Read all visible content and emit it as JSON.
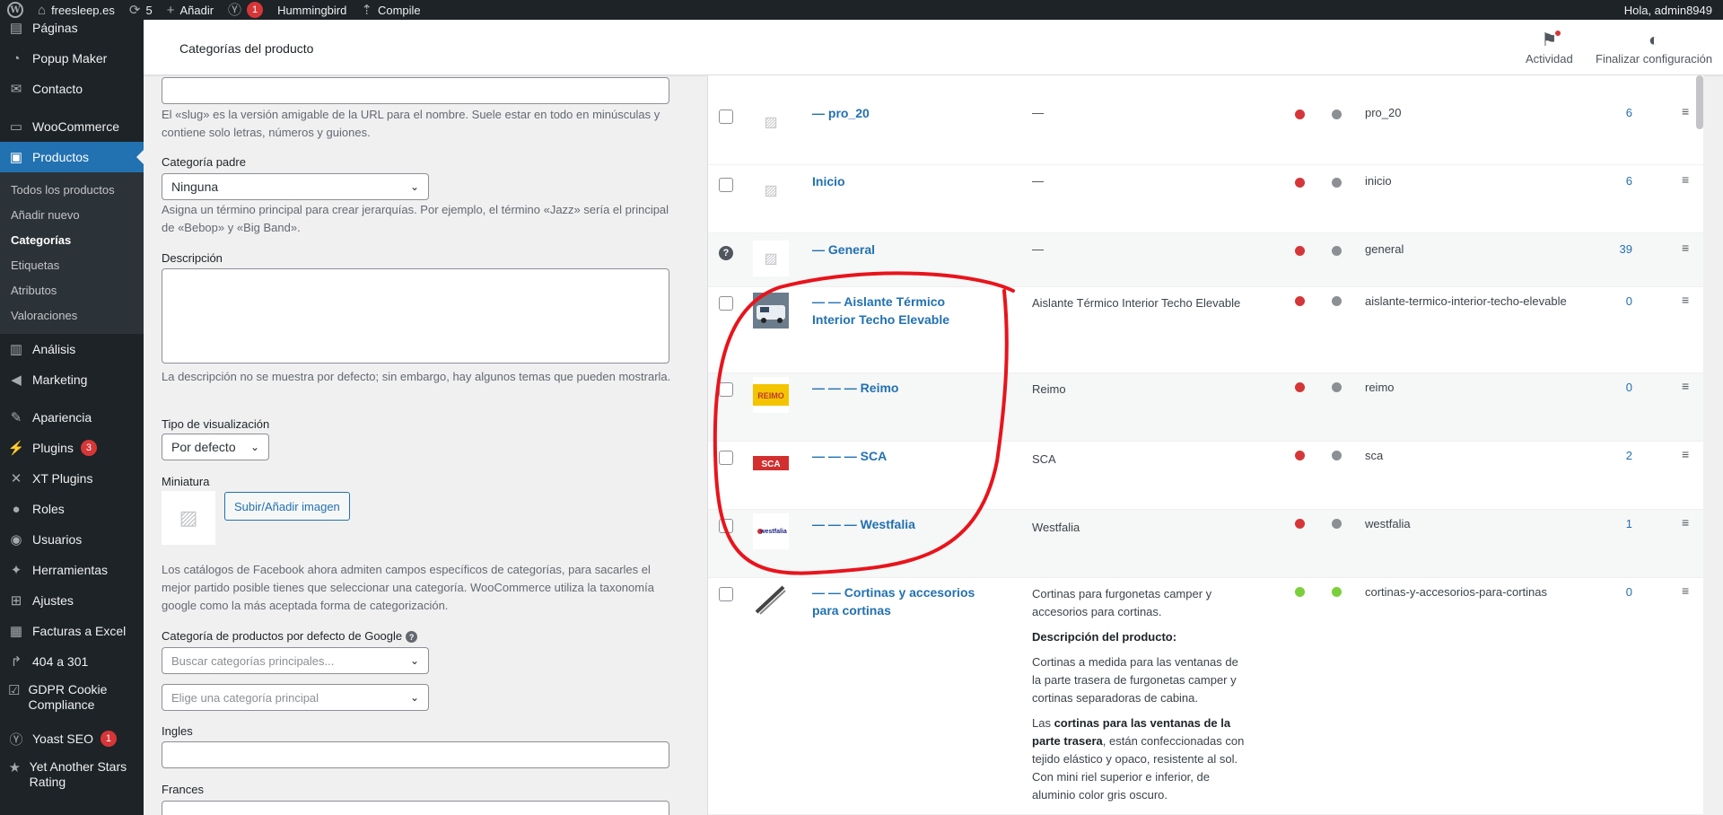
{
  "adminbar": {
    "site": "freesleep.es",
    "updates": "5",
    "add": "Añadir",
    "yoast_count": "1",
    "hummingbird": "Hummingbird",
    "compile": "Compile",
    "greeting": "Hola, admin8949"
  },
  "sidebar": {
    "items": [
      {
        "label": "Páginas",
        "icon": "page-icon"
      },
      {
        "label": "Popup Maker",
        "icon": "popup-icon"
      },
      {
        "label": "Contacto",
        "icon": "mail-icon"
      },
      {
        "label": "WooCommerce",
        "icon": "woo-icon"
      },
      {
        "label": "Productos",
        "icon": "archive-icon"
      }
    ],
    "submenu": [
      "Todos los productos",
      "Añadir nuevo",
      "Categorías",
      "Etiquetas",
      "Atributos",
      "Valoraciones"
    ],
    "items2": [
      {
        "label": "Análisis",
        "icon": "chart-icon"
      },
      {
        "label": "Marketing",
        "icon": "megaphone-icon"
      },
      {
        "label": "Apariencia",
        "icon": "brush-icon"
      },
      {
        "label": "Plugins",
        "icon": "plugin-icon",
        "badge": "3"
      },
      {
        "label": "XT Plugins",
        "icon": "xt-icon"
      },
      {
        "label": "Roles",
        "icon": "roles-icon"
      },
      {
        "label": "Usuarios",
        "icon": "user-icon"
      },
      {
        "label": "Herramientas",
        "icon": "wrench-icon"
      },
      {
        "label": "Ajustes",
        "icon": "settings-icon"
      },
      {
        "label": "Facturas a Excel",
        "icon": "spreadsheet-icon"
      },
      {
        "label": "404 a 301",
        "icon": "redirect-icon"
      },
      {
        "label": "GDPR Cookie Compliance",
        "icon": "shield-icon"
      },
      {
        "label": "Yoast SEO",
        "icon": "yoast-icon",
        "badge": "1"
      },
      {
        "label": "Yet Another Stars Rating",
        "icon": "star-icon"
      }
    ]
  },
  "header": {
    "title": "Categorías del producto",
    "activity": "Actividad",
    "finish": "Finalizar configuración"
  },
  "form": {
    "slug_hint": "El «slug» es la versión amigable de la URL para el nombre. Suele estar en todo en minúsculas y contiene solo letras, números y guiones.",
    "parent_label": "Categoría padre",
    "parent_value": "Ninguna",
    "parent_hint": "Asigna un término principal para crear jerarquías. Por ejemplo, el término «Jazz» sería el principal de «Bebop» y «Big Band».",
    "desc_label": "Descripción",
    "desc_hint": "La descripción no se muestra por defecto; sin embargo, hay algunos temas que pueden mostrarla.",
    "display_label": "Tipo de visualización",
    "display_value": "Por defecto",
    "thumb_label": "Miniatura",
    "upload_btn": "Subir/Añadir imagen",
    "fb_hint": "Los catálogos de Facebook ahora admiten campos específicos de categorías, para sacarles el mejor partido posible tienes que seleccionar una categoría. WooCommerce utiliza la taxonomía google como la más aceptada forma de categorización.",
    "google_label": "Categoría de productos por defecto de Google",
    "google_search_ph": "Buscar categorías principales...",
    "google_choose_ph": "Elige una categoría principal",
    "ingles_label": "Ingles",
    "frances_label": "Frances"
  },
  "table": {
    "rows": [
      {
        "name": "— pro_20",
        "desc": "—",
        "slug": "pro_20",
        "count": "6",
        "status1": "red",
        "status2": "gray"
      },
      {
        "name": "Inicio",
        "desc": "—",
        "slug": "inicio",
        "count": "6",
        "status1": "red",
        "status2": "gray"
      },
      {
        "name": "— General",
        "desc": "—",
        "slug": "general",
        "count": "39",
        "status1": "red",
        "status2": "gray"
      },
      {
        "name": "— — Aislante Térmico Interior Techo Elevable",
        "desc": "Aislante Térmico Interior Techo Elevable",
        "slug": "aislante-termico-interior-techo-elevable",
        "count": "0",
        "status1": "red",
        "status2": "gray"
      },
      {
        "name": "— — — Reimo",
        "desc": "Reimo",
        "slug": "reimo",
        "count": "0",
        "status1": "red",
        "status2": "gray",
        "logo": "REIMO"
      },
      {
        "name": "— — — SCA",
        "desc": "SCA",
        "slug": "sca",
        "count": "2",
        "status1": "red",
        "status2": "gray",
        "logo": "SCA"
      },
      {
        "name": "— — — Westfalia",
        "desc": "Westfalia",
        "slug": "westfalia",
        "count": "1",
        "status1": "red",
        "status2": "gray",
        "logo": "westfalia"
      },
      {
        "name": "— — Cortinas y accesorios para cortinas",
        "slug": "cortinas-y-accesorios-para-cortinas",
        "count": "0",
        "status1": "green",
        "status2": "green",
        "desc_p1": "Cortinas para furgonetas camper y accesorios para cortinas.",
        "desc_h": "Descripción del producto:",
        "desc_p2": "Cortinas a medida para las ventanas de la parte trasera de furgonetas camper y cortinas separadoras de cabina.",
        "desc_p3_bold": "cortinas para las ventanas de la parte trasera",
        "desc_p3_pre": "Las ",
        "desc_p3_post": ", están confeccionadas con tejido elástico y opaco, resistente al sol.",
        "desc_p4": "Con mini riel superior e inferior, de aluminio color gris oscuro."
      }
    ]
  }
}
